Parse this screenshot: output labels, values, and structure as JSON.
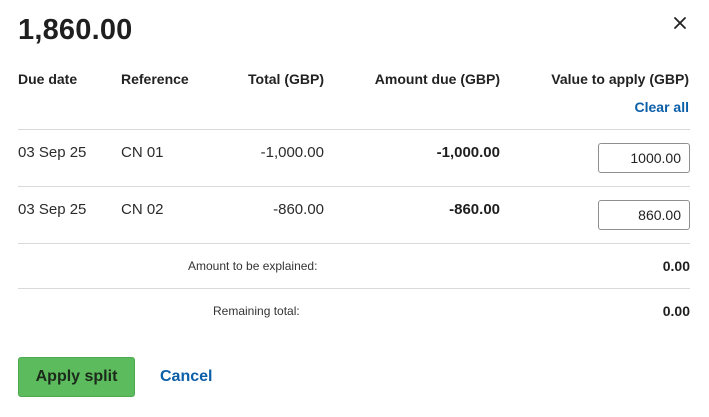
{
  "header": {
    "title": "1,860.00",
    "close_icon": "close-icon"
  },
  "table": {
    "columns": {
      "due_date": "Due date",
      "reference": "Reference",
      "total": "Total (GBP)",
      "amount_due": "Amount due (GBP)",
      "value_to_apply": "Value to apply (GBP)"
    },
    "clear_all": "Clear all",
    "rows": [
      {
        "due_date": "03 Sep 25",
        "reference": "CN 01",
        "total": "-1,000.00",
        "amount_due": "-1,000.00",
        "value": "1000.00"
      },
      {
        "due_date": "03 Sep 25",
        "reference": "CN 02",
        "total": "-860.00",
        "amount_due": "-860.00",
        "value": "860.00"
      }
    ]
  },
  "summary": {
    "amount_to_be_explained_label": "Amount to be explained:",
    "amount_to_be_explained_value": "0.00",
    "remaining_total_label": "Remaining total:",
    "remaining_total_value": "0.00"
  },
  "actions": {
    "apply_label": "Apply split",
    "cancel_label": "Cancel"
  },
  "colors": {
    "accent_link": "#0b5ea8",
    "apply_button": "#5cbb5c"
  }
}
